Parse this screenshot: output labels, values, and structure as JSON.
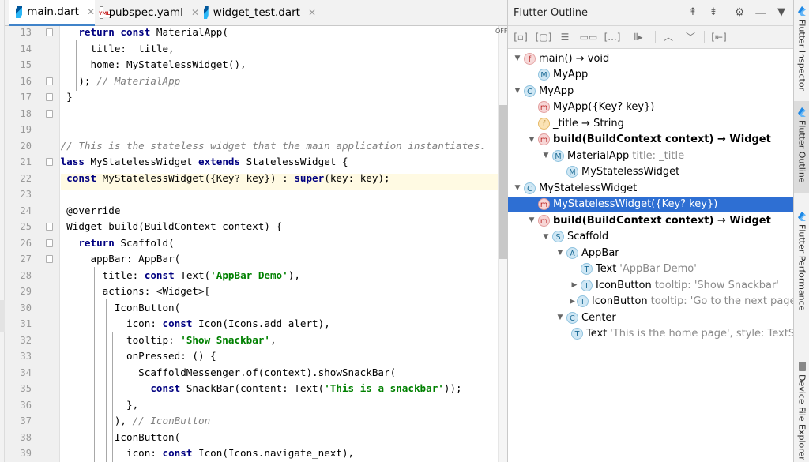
{
  "editor": {
    "tabs": [
      {
        "label": "main.dart",
        "icon": "dart-file-icon",
        "active": true
      },
      {
        "label": "pubspec.yaml",
        "icon": "yaml-file-icon",
        "active": false
      },
      {
        "label": "widget_test.dart",
        "icon": "dart-file-icon",
        "active": false
      }
    ],
    "off_label": "OFF",
    "line_numbers": [
      "13",
      "14",
      "15",
      "16",
      "17",
      "18",
      "19",
      "20",
      "21",
      "22",
      "23",
      "24",
      "25",
      "26",
      "27",
      "28",
      "29",
      "30",
      "31",
      "32",
      "33",
      "34",
      "35",
      "36",
      "37",
      "38",
      "39"
    ],
    "current_line": "22"
  },
  "outline": {
    "title": "Flutter Outline",
    "tree": [
      {
        "badge": "f",
        "label": "main() → void",
        "detail": "",
        "arrow": "down",
        "bold": false
      },
      {
        "badge": "M",
        "label": "MyApp",
        "detail": "",
        "arrow": "",
        "bold": false
      },
      {
        "badge": "C",
        "label": "MyApp",
        "detail": "",
        "arrow": "down",
        "bold": false
      },
      {
        "badge": "m",
        "label": "MyApp({Key? key})",
        "detail": "",
        "arrow": "",
        "bold": false
      },
      {
        "badge": "f",
        "label": "_title → String",
        "detail": "",
        "arrow": "",
        "bold": false
      },
      {
        "badge": "m",
        "label": "build(BuildContext context) → Widget",
        "detail": "",
        "arrow": "down",
        "bold": true
      },
      {
        "badge": "M",
        "label": "MaterialApp",
        "detail": "title: _title",
        "arrow": "down",
        "bold": false
      },
      {
        "badge": "M",
        "label": "MyStatelessWidget",
        "detail": "",
        "arrow": "",
        "bold": false
      },
      {
        "badge": "C",
        "label": "MyStatelessWidget",
        "detail": "",
        "arrow": "down",
        "bold": false
      },
      {
        "badge": "m",
        "label": "MyStatelessWidget({Key? key})",
        "detail": "",
        "arrow": "",
        "bold": false,
        "selected": true
      },
      {
        "badge": "m",
        "label": "build(BuildContext context) → Widget",
        "detail": "",
        "arrow": "down",
        "bold": true
      },
      {
        "badge": "S",
        "label": "Scaffold",
        "detail": "",
        "arrow": "down",
        "bold": false
      },
      {
        "badge": "A",
        "label": "AppBar",
        "detail": "",
        "arrow": "down",
        "bold": false
      },
      {
        "badge": "T",
        "label": "Text",
        "detail": "'AppBar Demo'",
        "arrow": "",
        "bold": false
      },
      {
        "badge": "I",
        "label": "IconButton",
        "detail": "tooltip: 'Show Snackbar'",
        "arrow": "right",
        "bold": false
      },
      {
        "badge": "I",
        "label": "IconButton",
        "detail": "tooltip: 'Go to the next page'",
        "arrow": "right",
        "bold": false
      },
      {
        "badge": "C",
        "label": "Center",
        "detail": "",
        "arrow": "down",
        "bold": false
      },
      {
        "badge": "T",
        "label": "Text",
        "detail": "'This is the home page', style: TextStyle",
        "arrow": "",
        "bold": false
      }
    ]
  },
  "tool_windows": {
    "inspector": "Flutter Inspector",
    "outline": "Flutter Outline",
    "performance": "Flutter Performance",
    "device_explorer": "Device File Explorer"
  }
}
